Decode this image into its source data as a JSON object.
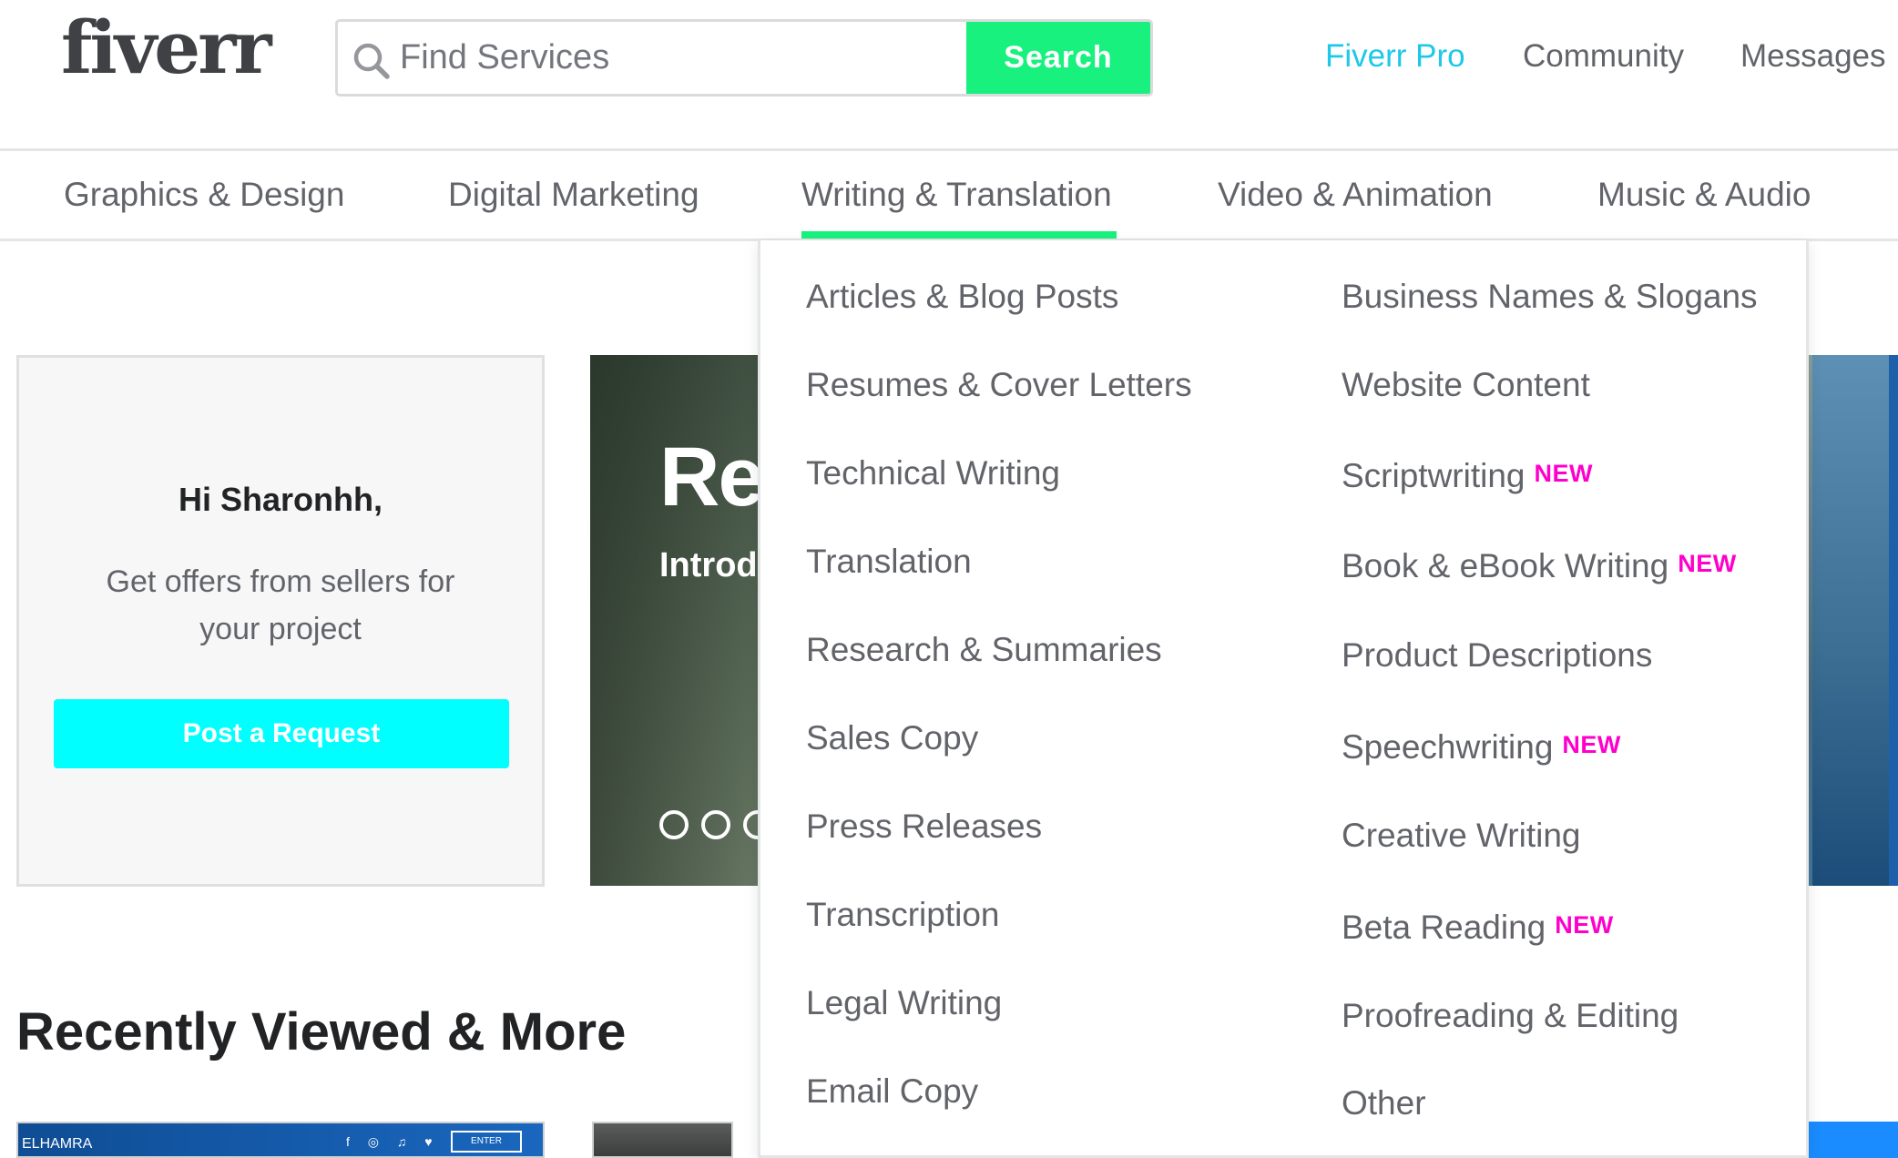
{
  "header": {
    "logo": "fiverr",
    "search": {
      "placeholder": "Find Services",
      "value": "",
      "button_label": "Search"
    },
    "nav": {
      "pro": "Fiverr Pro",
      "community": "Community",
      "messages": "Messages"
    }
  },
  "categories": [
    {
      "label": "Graphics & Design"
    },
    {
      "label": "Digital Marketing"
    },
    {
      "label": "Writing & Translation",
      "active": true
    },
    {
      "label": "Video & Animation"
    },
    {
      "label": "Music & Audio"
    }
  ],
  "welcome": {
    "greeting": "Hi Sharonhh,",
    "message": "Get offers from sellers for your project",
    "button_label": "Post a Request"
  },
  "banner": {
    "title_visible": "Re",
    "subtitle_visible": "Introd",
    "slide_count_visible": 3
  },
  "recently_viewed": {
    "title": "Recently Viewed & More",
    "thumb1_text": "ELHAMRA",
    "thumb1_button": "ENTER"
  },
  "dropdown": {
    "new_badge": "NEW",
    "left_column": [
      {
        "label": "Articles & Blog Posts"
      },
      {
        "label": "Resumes & Cover Letters"
      },
      {
        "label": "Technical Writing"
      },
      {
        "label": "Translation"
      },
      {
        "label": "Research & Summaries"
      },
      {
        "label": "Sales Copy"
      },
      {
        "label": "Press Releases"
      },
      {
        "label": "Transcription"
      },
      {
        "label": "Legal Writing"
      },
      {
        "label": "Email Copy"
      }
    ],
    "right_column": [
      {
        "label": "Business Names & Slogans",
        "is_new": false
      },
      {
        "label": "Website Content",
        "is_new": false
      },
      {
        "label": "Scriptwriting",
        "is_new": true
      },
      {
        "label": "Book & eBook Writing",
        "is_new": true
      },
      {
        "label": "Product Descriptions",
        "is_new": false
      },
      {
        "label": "Speechwriting",
        "is_new": true
      },
      {
        "label": "Creative Writing",
        "is_new": false
      },
      {
        "label": "Beta Reading",
        "is_new": true
      },
      {
        "label": "Proofreading & Editing",
        "is_new": false
      },
      {
        "label": "Other",
        "is_new": false
      }
    ]
  },
  "colors": {
    "brand_green": "#19f17e",
    "pro_blue": "#1dc8e8",
    "request_cyan": "#00ffff",
    "new_badge_magenta": "#ff00cc",
    "text_gray": "#62646a",
    "heading_dark": "#222325"
  }
}
